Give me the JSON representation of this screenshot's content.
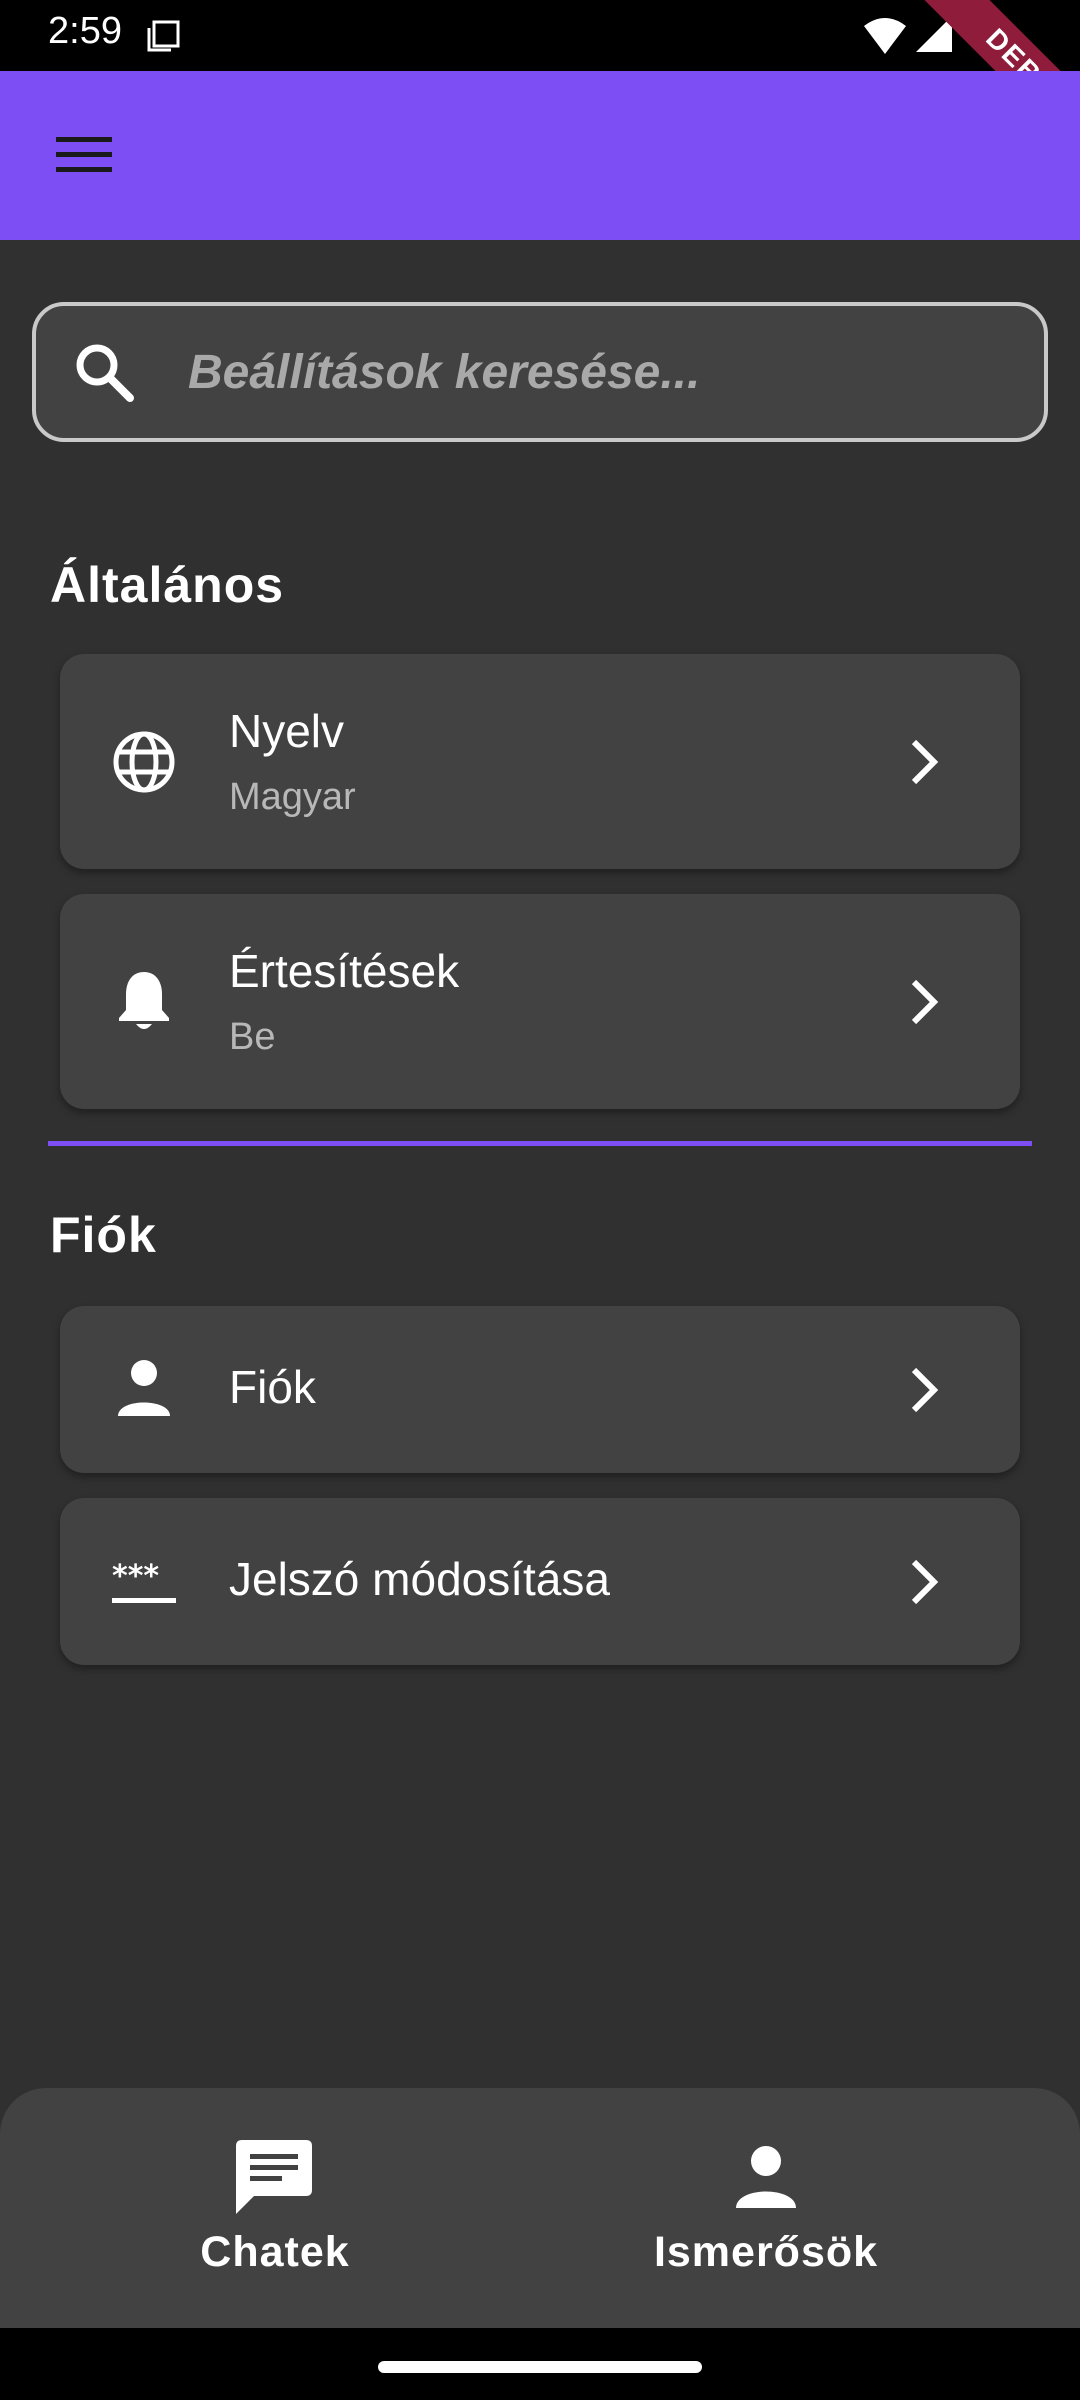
{
  "status_bar": {
    "time": "2:59",
    "debug_label": "DEBUG"
  },
  "app_bar": {
    "menu_icon": "menu-icon"
  },
  "search": {
    "placeholder": "Beállítások keresése...",
    "value": ""
  },
  "sections": {
    "general": {
      "title": "Általános",
      "items": [
        {
          "title": "Nyelv",
          "subtitle": "Magyar",
          "icon": "globe-icon"
        },
        {
          "title": "Értesítések",
          "subtitle": "Be",
          "icon": "bell-icon"
        }
      ]
    },
    "account": {
      "title": "Fiók",
      "items": [
        {
          "title": "Fiók",
          "icon": "person-icon"
        },
        {
          "title": "Jelszó módosítása",
          "icon": "password-icon"
        }
      ]
    }
  },
  "bottom_nav": {
    "items": [
      {
        "label": "Chatek",
        "icon": "chat-icon"
      },
      {
        "label": "Ismerősök",
        "icon": "person-icon"
      }
    ]
  },
  "colors": {
    "accent": "#7c4ef3",
    "background": "#303030",
    "surface": "#424242",
    "debug_banner": "#8e1c3a"
  }
}
